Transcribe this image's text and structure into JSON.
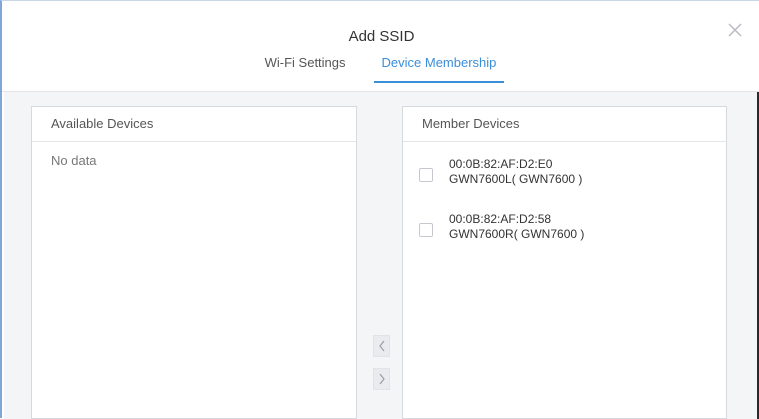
{
  "dialog": {
    "title": "Add SSID",
    "tabs": [
      {
        "label": "Wi-Fi Settings",
        "active": false
      },
      {
        "label": "Device Membership",
        "active": true
      }
    ],
    "close_icon": "close-icon",
    "accent_color": "#3b8fd9"
  },
  "available_devices": {
    "header": "Available Devices",
    "empty_text": "No data"
  },
  "member_devices": {
    "header": "Member Devices",
    "items": [
      {
        "mac": "00:0B:82:AF:D2:E0",
        "name": "GWN7600L( GWN7600 )",
        "checked": false
      },
      {
        "mac": "00:0B:82:AF:D2:58",
        "name": "GWN7600R( GWN7600 )",
        "checked": false
      }
    ]
  },
  "transfer": {
    "left_icon": "chevron-left-icon",
    "right_icon": "chevron-right-icon"
  }
}
